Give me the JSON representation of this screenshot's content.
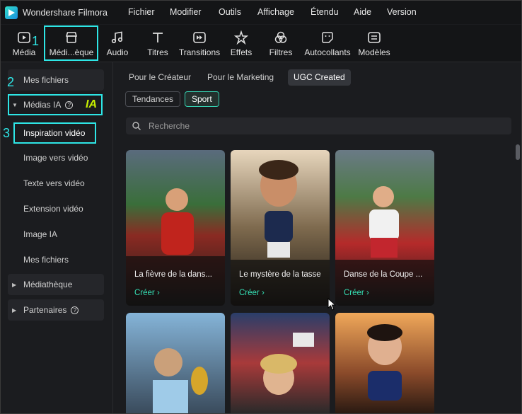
{
  "app": {
    "title": "Wondershare Filmora"
  },
  "menu": [
    "Fichier",
    "Modifier",
    "Outils",
    "Affichage",
    "Étendu",
    "Aide",
    "Version"
  ],
  "toolbar": [
    {
      "label": "Média",
      "icon": "media-icon"
    },
    {
      "label": "Médi...èque",
      "icon": "store-icon"
    },
    {
      "label": "Audio",
      "icon": "music-note-icon"
    },
    {
      "label": "Titres",
      "icon": "text-icon"
    },
    {
      "label": "Transitions",
      "icon": "transitions-icon"
    },
    {
      "label": "Effets",
      "icon": "effects-icon"
    },
    {
      "label": "Filtres",
      "icon": "filters-icon"
    },
    {
      "label": "Autocollants",
      "icon": "sticker-icon"
    },
    {
      "label": "Modèles",
      "icon": "templates-icon"
    }
  ],
  "annotations": {
    "n1": "1",
    "n2": "2",
    "n3": "3",
    "ia": "IA",
    "accent": "#2ee6e6"
  },
  "sidebar": {
    "items": [
      "Mes fichiers",
      "Médias IA",
      "Inspiration vidéo",
      "Image vers vidéo",
      "Texte vers vidéo",
      "Extension vidéo",
      "Image IA",
      "Mes fichiers",
      "Médiathèque",
      "Partenaires"
    ],
    "help_glyph": "?"
  },
  "tabs": [
    "Pour le Créateur",
    "Pour le Marketing",
    "UGC Created"
  ],
  "chips": [
    "Tendances",
    "Sport"
  ],
  "search": {
    "placeholder": "Recherche"
  },
  "cards": [
    {
      "title": "La fièvre de la dans...",
      "cta": "Créer  ›"
    },
    {
      "title": "Le mystère de la tasse",
      "cta": "Créer  ›"
    },
    {
      "title": "Danse de la Coupe ...",
      "cta": "Créer  ›"
    },
    {
      "title": "",
      "cta": ""
    },
    {
      "title": "",
      "cta": ""
    },
    {
      "title": "",
      "cta": ""
    }
  ],
  "colors": {
    "accent_green": "#35e0b5",
    "highlight": "#2ee6e6",
    "ia_green": "#c8f000"
  }
}
